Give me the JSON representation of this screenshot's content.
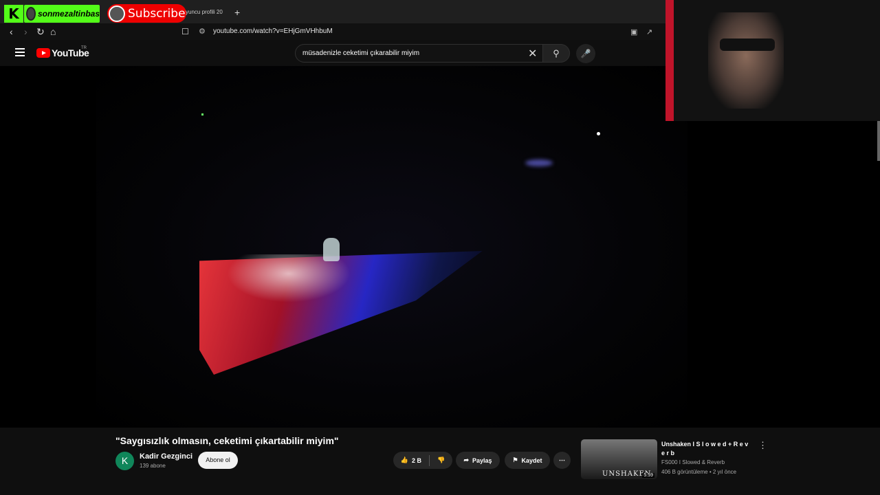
{
  "overlay": {
    "kick_logo": "K",
    "kick_username": "sonmezaltinbas",
    "subscribe_label": "Subscribe"
  },
  "browser": {
    "tab_title": "yuncu profili 20",
    "new_tab": "+",
    "url": "youtube.com/watch?v=EHjGmVHhbuM"
  },
  "youtube": {
    "logo_text": "YouTube",
    "country_code": "TR",
    "search_query": "müsadenizle ceketimi çıkarabilir miyim"
  },
  "video": {
    "title": "\"Saygısızlık olmasın, ceketimi çıkartabilir miyim\"",
    "channel_initial": "K",
    "channel_name": "Kadir Gezginci",
    "subscriber_count": "139 abone",
    "subscribe_label": "Abone ol",
    "like_count": "2 B",
    "share_label": "Paylaş",
    "save_label": "Kaydet"
  },
  "recommendation": {
    "title": "Unshaken I S l o w e d + R e v e r b",
    "channel": "FS000 I Slowed & Reverb",
    "meta": "406 B görüntüleme • 2 yıl önce",
    "thumbnail_text": "UNSHAKEN",
    "duration": "5:59"
  }
}
